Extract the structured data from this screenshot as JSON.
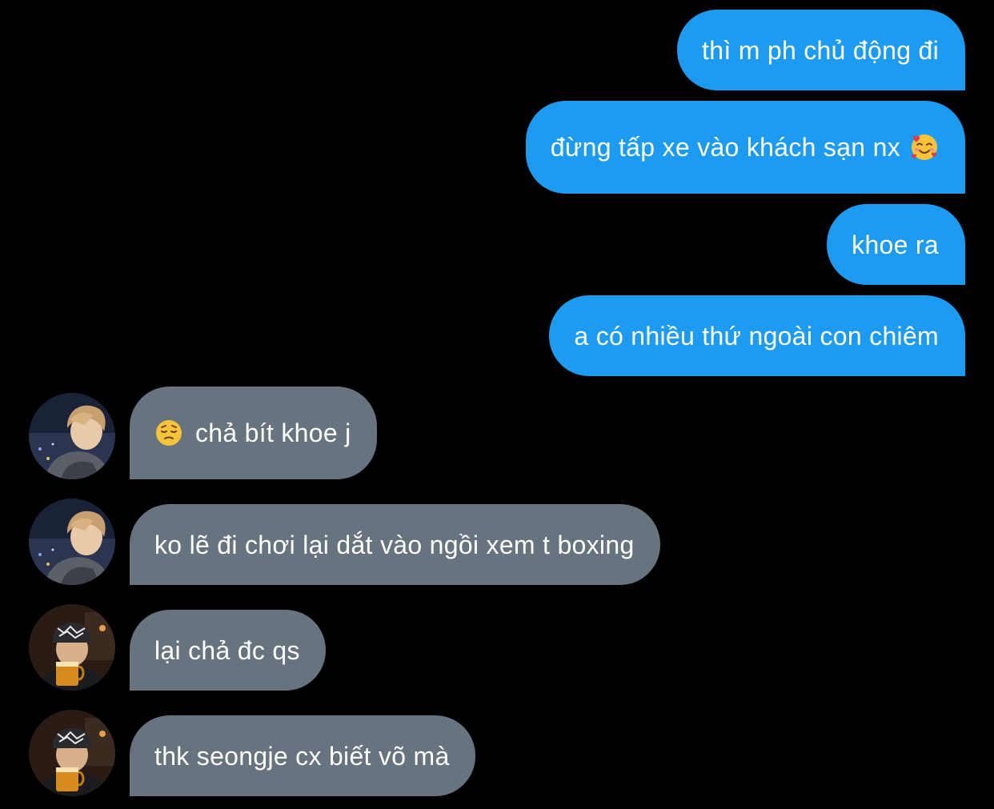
{
  "messages": [
    {
      "direction": "outgoing",
      "text": "thì m ph chủ động đi"
    },
    {
      "direction": "outgoing",
      "text": "đừng tấp xe vào khách sạn nx",
      "emoji": "smiling-face-with-hearts-icon"
    },
    {
      "direction": "outgoing",
      "text": "khoe ra"
    },
    {
      "direction": "outgoing",
      "text": "a có nhiều thứ ngoài con chiêm"
    },
    {
      "direction": "incoming",
      "avatar": "avatar-boy-blond-icon",
      "emoji": "pensive-face-icon",
      "text": "chả bít khoe j"
    },
    {
      "direction": "incoming",
      "avatar": "avatar-boy-blond-icon",
      "text": "ko lẽ đi chơi lại dắt vào ngồi xem t boxing"
    },
    {
      "direction": "incoming",
      "avatar": "avatar-boy-beanie-icon",
      "text": "lại chả đc qs"
    },
    {
      "direction": "incoming",
      "avatar": "avatar-boy-beanie-icon",
      "text": "thk seongje cx biết võ mà"
    }
  ],
  "colors": {
    "background": "#000000",
    "outgoing_bubble": "#1d9bf0",
    "incoming_bubble": "#67737f",
    "text": "#ffffff"
  }
}
